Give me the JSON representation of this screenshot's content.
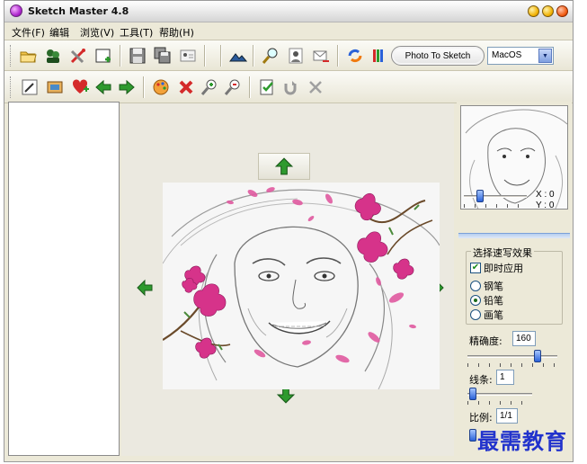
{
  "window": {
    "title": "Sketch Master 4.8"
  },
  "menu": {
    "items": [
      {
        "label": "文件(F)"
      },
      {
        "label": "编辑"
      },
      {
        "label": "浏览(V)"
      },
      {
        "label": "工具(T)"
      },
      {
        "label": "帮助(H)"
      }
    ]
  },
  "toolbar1": {
    "photo_to_sketch_label": "Photo To Sketch",
    "style_select_value": "MacOS"
  },
  "right_panel": {
    "preview_x_label": "X : 0",
    "preview_y_label": "Y : 0",
    "effect_group_title": "选择速写效果",
    "instant_apply_label": "即时应用",
    "instant_apply_checked": true,
    "effect_options": [
      {
        "label": "钢笔",
        "selected": false
      },
      {
        "label": "铅笔",
        "selected": true
      },
      {
        "label": "画笔",
        "selected": false
      }
    ],
    "precision_label": "精确度:",
    "precision_value": "160",
    "lines_label": "线条:",
    "lines_value": "1",
    "ratio_label": "比例:",
    "ratio_value": "1/1"
  },
  "watermark": {
    "text": "最需教育"
  },
  "colors": {
    "accent_green": "#2e9a2e",
    "title_bar": "#e6e6e6",
    "watermark": "#2233cc",
    "blossom_pink": "#d6338a"
  }
}
